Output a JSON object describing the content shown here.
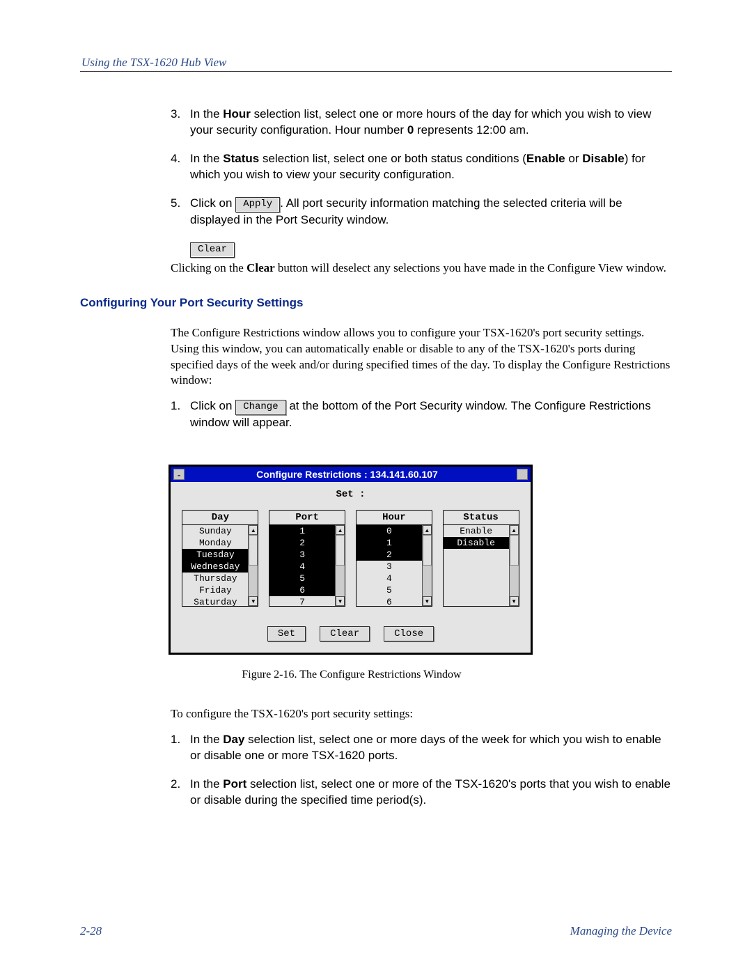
{
  "header": {
    "running": "Using the TSX-1620 Hub View"
  },
  "steps_a": {
    "s3": {
      "num": "3.",
      "pre": "In the ",
      "bold1": "Hour",
      "mid1": " selection list, select one or more hours of the day for which you wish to view your security configuration. Hour number ",
      "bold2": "0",
      "post": " represents 12:00 am."
    },
    "s4": {
      "num": "4.",
      "pre": "In the ",
      "bold1": "Status",
      "mid1": " selection list, select one or both status conditions (",
      "bold2": "Enable",
      "mid2": " or ",
      "bold3": "Disable",
      "post": ") for which you wish to view your security configuration."
    },
    "s5": {
      "num": "5.",
      "pre": "Click on ",
      "btn": "Apply",
      "post": ". All port security information matching the selected criteria will be displayed in the Port Security window."
    }
  },
  "clear": {
    "btn": "Clear",
    "para_pre": "Clicking on the ",
    "para_bold": "Clear",
    "para_post": " button will deselect any selections you have made in the Configure View window."
  },
  "section_title": "Configuring Your Port Security Settings",
  "intro": "The Configure Restrictions window allows you to configure your TSX-1620's port security settings. Using this window, you can automatically enable or disable to any of the TSX-1620's ports during specified days of the week and/or during specified times of the day. To display the Configure Restrictions window:",
  "step_b1": {
    "num": "1.",
    "pre": "Click on ",
    "btn": "Change",
    "post": " at the bottom of the Port Security window. The Configure Restrictions window will appear."
  },
  "window": {
    "title": "Configure Restrictions : 134.141.60.107",
    "set_label": "Set :",
    "cols": {
      "day": {
        "head": "Day",
        "items": [
          "Sunday",
          "Monday",
          "Tuesday",
          "Wednesday",
          "Thursday",
          "Friday",
          "Saturday"
        ],
        "selected": [
          2,
          3
        ]
      },
      "port": {
        "head": "Port",
        "items": [
          "1",
          "2",
          "3",
          "4",
          "5",
          "6",
          "7"
        ],
        "selected": [
          0,
          1,
          2,
          3,
          4,
          5
        ]
      },
      "hour": {
        "head": "Hour",
        "items": [
          "0",
          "1",
          "2",
          "3",
          "4",
          "5",
          "6"
        ],
        "selected": [
          0,
          1,
          2
        ]
      },
      "status": {
        "head": "Status",
        "items": [
          "Enable",
          "Disable"
        ],
        "selected": [
          1
        ]
      }
    },
    "buttons": {
      "set": "Set",
      "clear": "Clear",
      "close": "Close"
    }
  },
  "caption": "Figure 2-16. The Configure Restrictions Window",
  "post_fig_intro": "To configure the TSX-1620's port security settings:",
  "steps_c": {
    "s1": {
      "num": "1.",
      "pre": "In the ",
      "bold1": "Day",
      "post": " selection list, select one or more days of the week for which you wish to enable or disable one or more TSX-1620 ports."
    },
    "s2": {
      "num": "2.",
      "pre": "In the ",
      "bold1": "Port",
      "post": " selection list, select one or more of the TSX-1620's ports that you wish to enable or disable during the specified time period(s)."
    }
  },
  "footer": {
    "left": "2-28",
    "right": "Managing the Device"
  }
}
